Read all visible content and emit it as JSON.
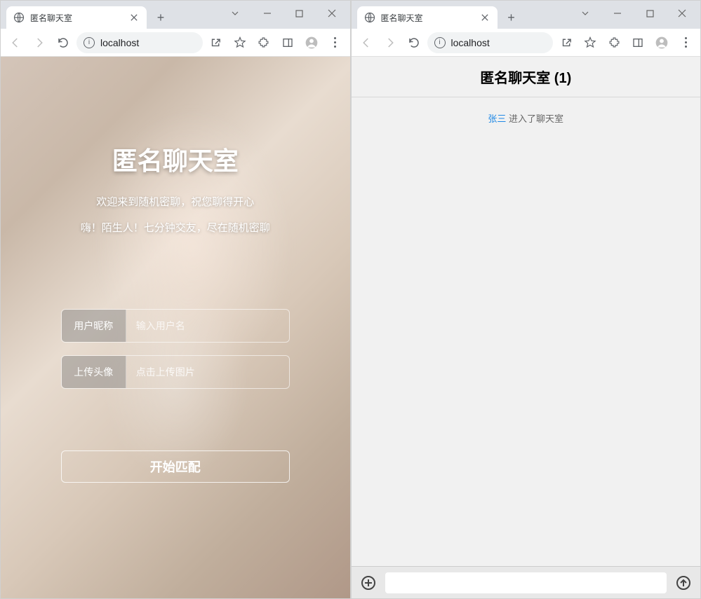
{
  "browser": {
    "tab_title": "匿名聊天室",
    "url": "localhost",
    "new_tab_label": "+"
  },
  "left": {
    "title": "匿名聊天室",
    "subtitle1": "欢迎来到随机密聊，祝您聊得开心",
    "subtitle2": "嗨！陌生人！七分钟交友，尽在随机密聊",
    "nickname_label": "用户昵称",
    "nickname_placeholder": "输入用户名",
    "avatar_label": "上传头像",
    "avatar_text": "点击上传图片",
    "start_button": "开始匹配"
  },
  "right": {
    "header": "匿名聊天室 (1)",
    "sys_user": "张三",
    "sys_action": " 进入了聊天室",
    "input_placeholder": ""
  }
}
